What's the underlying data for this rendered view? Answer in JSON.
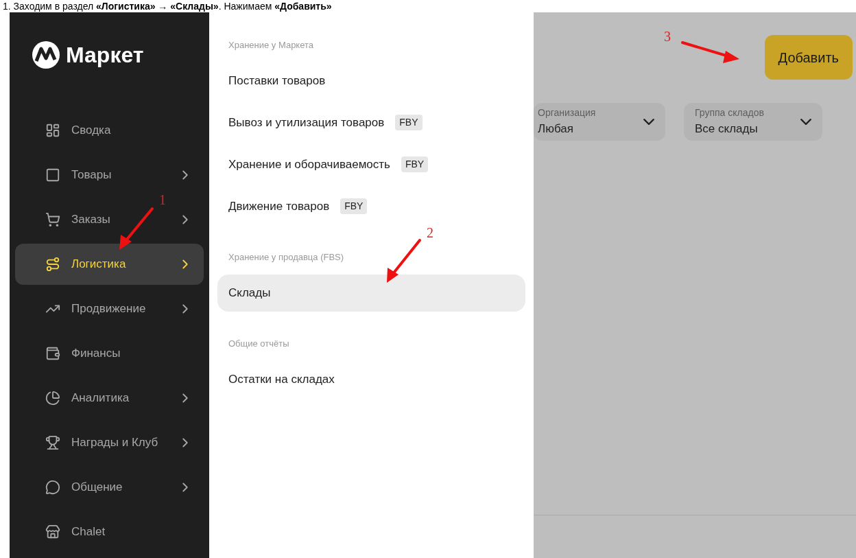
{
  "caption": "1. Заходим в раздел **«Логистика»** → **«Склады»**. Нажимаем **«Добавить»**",
  "logo": {
    "text": "Маркет"
  },
  "sidebar": {
    "items": [
      {
        "label": "Сводка",
        "selected": false,
        "has_submenu": false
      },
      {
        "label": "Товары",
        "selected": false,
        "has_submenu": true
      },
      {
        "label": "Заказы",
        "selected": false,
        "has_submenu": true
      },
      {
        "label": "Логистика",
        "selected": true,
        "has_submenu": true
      },
      {
        "label": "Продвижение",
        "selected": false,
        "has_submenu": true
      },
      {
        "label": "Финансы",
        "selected": false,
        "has_submenu": false
      },
      {
        "label": "Аналитика",
        "selected": false,
        "has_submenu": true
      },
      {
        "label": "Награды и Клуб",
        "selected": false,
        "has_submenu": true
      },
      {
        "label": "Общение",
        "selected": false,
        "has_submenu": true
      },
      {
        "label": "Chalet",
        "selected": false,
        "has_submenu": false
      }
    ]
  },
  "submenu": {
    "sections": [
      {
        "title": "Хранение у Маркета",
        "items": [
          {
            "label": "Поставки товаров",
            "selected": false
          },
          {
            "label": "Вывоз и утилизация товаров",
            "badge": "FBY",
            "selected": false
          },
          {
            "label": "Хранение и оборачиваемость",
            "badge": "FBY",
            "selected": false
          },
          {
            "label": "Движение товаров",
            "badge": "FBY",
            "selected": false
          }
        ]
      },
      {
        "title": "Хранение у продавца (FBS)",
        "items": [
          {
            "label": "Склады",
            "selected": true
          }
        ]
      },
      {
        "title": "Общие отчёты",
        "items": [
          {
            "label": "Остатки на складах",
            "selected": false
          }
        ]
      }
    ]
  },
  "add_button": "Добавить",
  "filters": [
    {
      "label": "Организация",
      "value": "Любая"
    },
    {
      "label": "Группа складов",
      "value": "Все склады"
    }
  ],
  "annotations": [
    {
      "label": "1"
    },
    {
      "label": "2"
    },
    {
      "label": "3"
    }
  ]
}
